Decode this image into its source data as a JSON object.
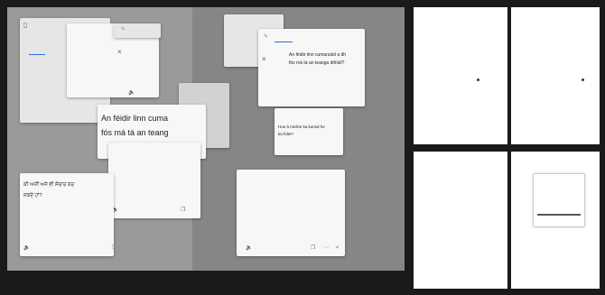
{
  "cards": {
    "top_left": {
      "tabs": [
        "",
        "",
        ""
      ],
      "line1": "",
      "line2": ""
    },
    "top_mid": {
      "tabs": [
        "",
        "",
        ""
      ],
      "line1": "",
      "line2": ""
    },
    "top_right_back": {
      "line1": "",
      "line2": "",
      "line3": ""
    },
    "top_right": {
      "tabs": [
        "",
        "",
        ""
      ],
      "line1": "An féidir linn cumarsáid a dh",
      "line2": "fós má tá an teanga difriúil?"
    },
    "center_big": {
      "line1": "An féidir linn cuma",
      "line2": "fós má tá an teang"
    },
    "center_small": {
      "tabs": [
        "",
        "",
        ""
      ],
      "line1": "Hoe à meikin ka kumal he",
      "line2": "ka fület?"
    },
    "script_card": {
      "line1": "",
      "line2": "",
      "sub1": "",
      "sub2": ""
    },
    "bottom_left": {
      "line1": "ਕੀ ਅਸੀਂ ਅਜੇ ਵੀ ਸੰਚਾਰ ਕਰ",
      "line2": "ਸਕਦੇ ਹਾਂ?",
      "sub1": "",
      "sub2": ""
    },
    "right_script": {
      "tabs": [
        "",
        "",
        ""
      ],
      "line1": "",
      "line2": "",
      "sub1": "",
      "sub2": ""
    }
  },
  "panels": {
    "top_center": {
      "label_a": "",
      "label_b": ""
    },
    "bottom_left": {
      "item1_num": "",
      "item1_text": "",
      "item2_num": "",
      "item2_text": "",
      "footer": ""
    },
    "bottom_right": {
      "title": "",
      "caption": ""
    }
  },
  "icons": {
    "close": "×",
    "edit": "✎",
    "speaker": "🔈",
    "copy": "❐",
    "share": "<",
    "back": "<",
    "tune": "⋯"
  }
}
